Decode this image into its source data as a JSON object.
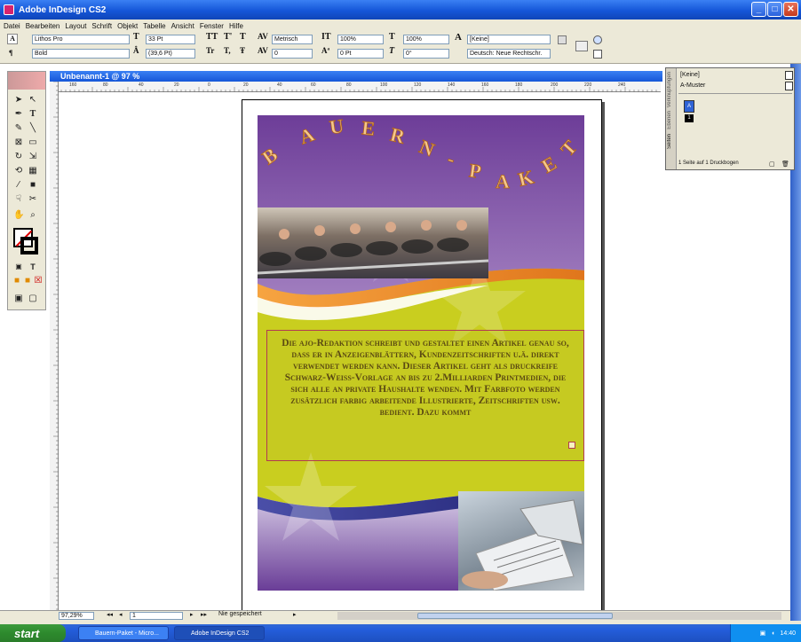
{
  "window": {
    "title": "Adobe InDesign CS2",
    "minimize": "_",
    "maximize": "□",
    "close": "✕"
  },
  "menu": [
    "Datei",
    "Bearbeiten",
    "Layout",
    "Schrift",
    "Objekt",
    "Tabelle",
    "Ansicht",
    "Fenster",
    "Hilfe"
  ],
  "control_panel": {
    "font_family": "Lithos Pro",
    "font_style": "Bold",
    "font_size": "33 Pt",
    "leading": "(39,6 Pt)",
    "kerning": "Metrisch",
    "tracking": "0",
    "vertical_scale": "100%",
    "baseline_shift": "0 Pt",
    "horizontal_scale": "100%",
    "skew": "0°",
    "char_style": "[Keine]",
    "language": "Deutsch: Neue Rechtschr."
  },
  "document": {
    "tab_title": "Unbenannt-1 @ 97 %",
    "ruler_ticks": [
      "160",
      "80",
      "40",
      "20",
      "0",
      "20",
      "40",
      "60",
      "80",
      "100",
      "120",
      "140",
      "160",
      "180",
      "200",
      "220",
      "240"
    ],
    "headline_letters": [
      "B",
      "A",
      "U",
      "E",
      "R",
      "N",
      "-",
      "P",
      "A",
      "K",
      "E",
      "T"
    ],
    "body_text": "Die ajo-Redaktion schreibt und gestaltet einen Artikel genau so, dass er in Anzeigenblättern, Kundenzeitschriften u.ä. direkt verwendet werden kann. Dieser Artikel geht als druckreife Schwarz-Weiss-Vorlage an bis zu 2.Milliarden Printmedien, die sich alle an private Haushalte wenden. Mit Farbfoto werden zusätzlich farbig arbeitende Illustrierte, Zeitschriften usw. bedient. Dazu kommt"
  },
  "pages_panel": {
    "tabs": [
      "Seiten",
      "Ebenen",
      "Verknüpfungen"
    ],
    "none_master": "[Keine]",
    "a_master": "A-Muster",
    "page_label": "1",
    "footer": "1 Seite auf 1 Druckbogen"
  },
  "status": {
    "zoom": "97,29%",
    "page": "1",
    "save_state": "Nie gespeichert"
  },
  "taskbar": {
    "start": "start",
    "items": [
      "Bauern-Paket - Micro...",
      "Adobe InDesign CS2"
    ],
    "time": "14:40"
  },
  "colors": {
    "purple": "#7b4aa0",
    "lime": "#c7cc1e",
    "orange": "#f08a1e",
    "navy": "#2a2e8a"
  }
}
